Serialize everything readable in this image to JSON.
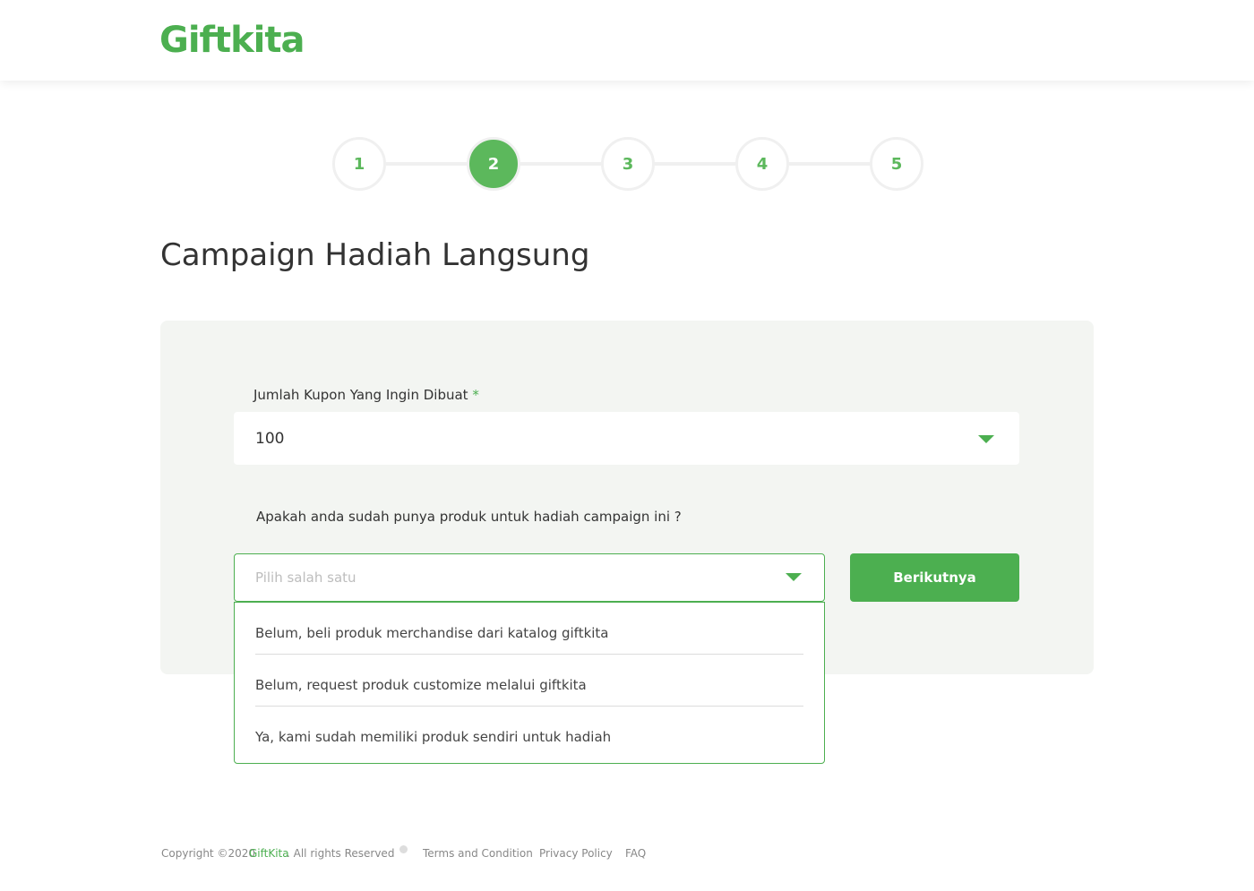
{
  "header": {
    "logo": "Giftkita"
  },
  "stepper": {
    "steps": [
      "1",
      "2",
      "3",
      "4",
      "5"
    ],
    "active": 2
  },
  "page_title": "Campaign Hadiah Langsung",
  "form": {
    "coupon": {
      "label": "Jumlah Kupon Yang Ingin Dibuat",
      "required_mark": "*",
      "value": "100"
    },
    "product": {
      "label": "Apakah anda sudah punya produk untuk hadiah campaign ini ?",
      "placeholder": "Pilih salah satu",
      "options": [
        "Belum, beli produk merchandise dari katalog giftkita",
        "Belum, request produk customize melalui giftkita",
        "Ya, kami sudah memiliki produk sendiri untuk hadiah"
      ]
    },
    "next_button": "Berikutnya"
  },
  "footer": {
    "copyright_prefix": "Copyright ©2020",
    "brand": "GiftKita",
    "copyright_suffix": ". All rights Reserved",
    "links": [
      "Terms and Condition",
      "Privacy Policy",
      "FAQ"
    ]
  },
  "colors": {
    "accent": "#4caf50",
    "step_active": "#5cb85c",
    "card_bg": "#f3f5f2"
  }
}
